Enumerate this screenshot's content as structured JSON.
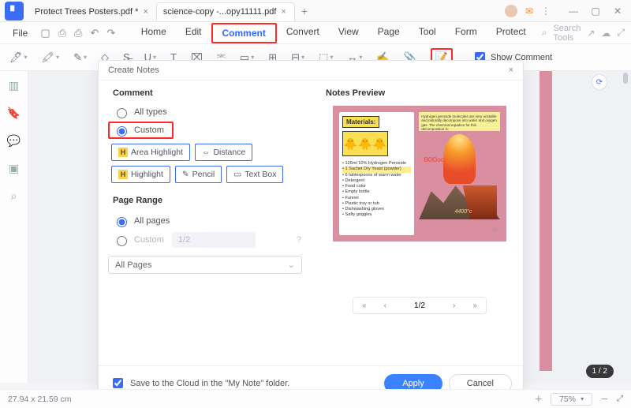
{
  "titlebar": {
    "tabs": [
      {
        "label": "Protect Trees Posters.pdf *",
        "active": false
      },
      {
        "label": "science-copy -...opy11111.pdf",
        "active": true
      }
    ]
  },
  "menubar": {
    "file": "File",
    "items": [
      "Home",
      "Edit",
      "Comment",
      "Convert",
      "View",
      "Page",
      "Tool",
      "Form",
      "Protect"
    ],
    "active_index": 2,
    "search_placeholder": "Search Tools"
  },
  "toolbar": {
    "show_comment_label": "Show Comment",
    "show_comment_checked": true
  },
  "dialog": {
    "title": "Create Notes",
    "close": "×",
    "comment": {
      "heading": "Comment",
      "all_types": "All types",
      "custom": "Custom",
      "selected": "custom",
      "chips": [
        "Area Highlight",
        "Distance",
        "Highlight",
        "Pencil",
        "Text Box"
      ]
    },
    "page_range": {
      "heading": "Page Range",
      "all_pages": "All pages",
      "custom": "Custom",
      "selected": "all",
      "custom_value": "1/2",
      "select_value": "All Pages"
    },
    "preview": {
      "heading": "Notes Preview",
      "materials_label": "Materials:",
      "materials_items": [
        "125ml 10% Hydrogen Peroxide",
        "1 Sachet Dry Yeast (powder)",
        "6 tablespoons of warm water",
        "Detergent",
        "Food color",
        "Empty bottle",
        "Funnel",
        "Plastic tray or tub",
        "Dishwashing gloves",
        "Safty goggles"
      ],
      "note_top": "Hydrogen peroxide molecules are very unstable and naturally decompose into water and oxygen gas. The chemical equation for this decomposition is:",
      "boom": "BOOooom",
      "temp": "4400°c",
      "page_mini": "03",
      "pager_value": "1/2"
    },
    "footer": {
      "save_cloud_label": "Save to the Cloud in the \"My Note\" folder.",
      "apply": "Apply",
      "cancel": "Cancel"
    }
  },
  "doc": {
    "page_counter": "1 / 2"
  },
  "statusbar": {
    "dimensions": "27.94 x 21.59 cm",
    "zoom": "75%"
  }
}
